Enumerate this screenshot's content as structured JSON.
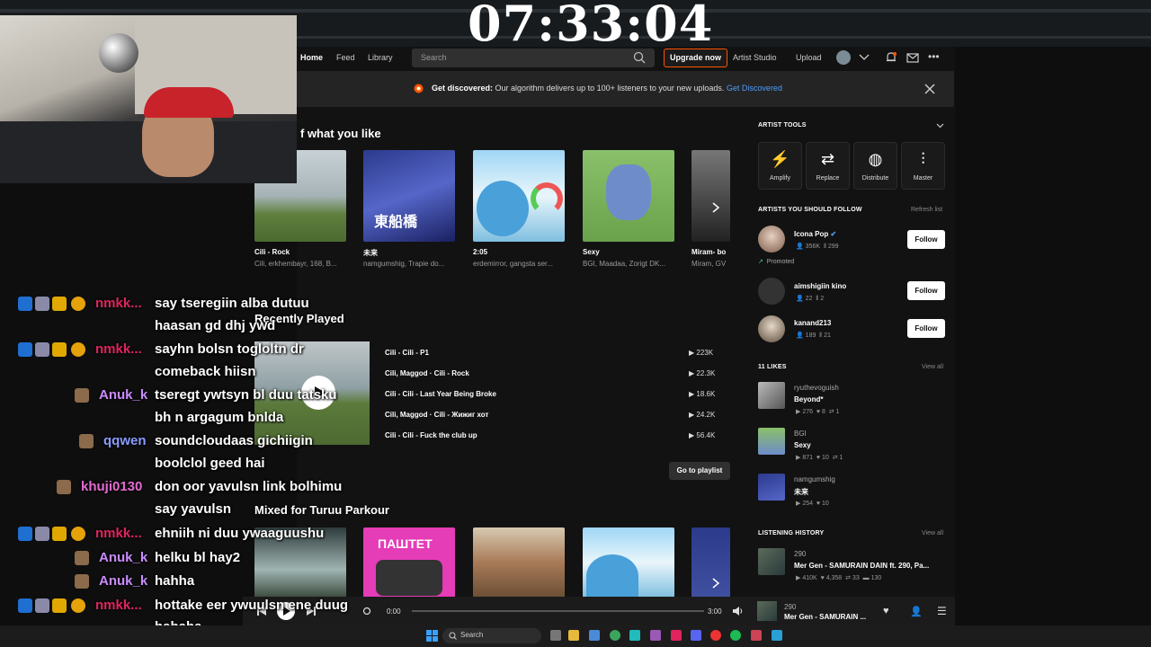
{
  "stream": {
    "timer": "07:33:04"
  },
  "nav": {
    "home": "Home",
    "feed": "Feed",
    "library": "Library",
    "search_placeholder": "Search",
    "upgrade": "Upgrade now",
    "artist_studio": "Artist Studio",
    "upload": "Upload"
  },
  "banner": {
    "bold": "Get discovered:",
    "text": " Our algorithm delivers up to 100+ listeners to your new uploads. ",
    "link": "Get Discovered"
  },
  "section1": {
    "title": "f what you like",
    "tiles": [
      {
        "name": "Cili - Rock",
        "sub": "Cili, erkhembayr, 168, B..."
      },
      {
        "name": "未来",
        "sub": "namgumshig, Trapie do..."
      },
      {
        "name": "2:05",
        "sub": "erdemirror, gangsta ser..."
      },
      {
        "name": "Sexy",
        "sub": "BGI, Maadaa, Zorigt DK..."
      },
      {
        "name": "Miram- bo",
        "sub": "Miram, GV"
      }
    ],
    "art_text": "東船橋"
  },
  "recently_played": {
    "title": "Recently Played",
    "tracks": [
      {
        "title": "Cili - Cili - P1",
        "plays": "223K"
      },
      {
        "title": "Cili, Maggod · Cili - Rock",
        "plays": "22.3K"
      },
      {
        "title": "Cili - Cili - Last Year Being Broke",
        "plays": "18.6K"
      },
      {
        "title": "Cili, Maggod · Cili - Жижиг хот",
        "plays": "24.2K"
      },
      {
        "title": "Cili - Cili - Fuck the club up",
        "plays": "56.4K"
      }
    ],
    "goto": "Go to playlist"
  },
  "section3": {
    "title": "Mixed for Turuu Parkour",
    "art_text": "ПАШТЕТ"
  },
  "sidebar": {
    "artist_tools": "ARTIST TOOLS",
    "tools": [
      "Amplify",
      "Replace",
      "Distribute",
      "Master"
    ],
    "follow_title": "ARTISTS YOU SHOULD FOLLOW",
    "refresh": "Refresh list",
    "artists": [
      {
        "name": "Icona Pop",
        "followers": "356K",
        "tracks": "299",
        "promoted": "Promoted",
        "btn": "Follow"
      },
      {
        "name": "aimshigiin kino",
        "followers": "22",
        "tracks": "2",
        "btn": "Follow"
      },
      {
        "name": "kanand213",
        "followers": "189",
        "tracks": "21",
        "btn": "Follow"
      }
    ],
    "likes_title": "11 LIKES",
    "view_all": "View all",
    "likes": [
      {
        "artist": "ryuthevoguish",
        "title": "Beyond*",
        "plays": "276",
        "likes": "8",
        "reposts": "1"
      },
      {
        "artist": "BGI",
        "title": "Sexy",
        "plays": "871",
        "likes": "10",
        "reposts": "1"
      },
      {
        "artist": "namgumshig",
        "title": "未来",
        "plays": "254",
        "likes": "10"
      }
    ],
    "history_title": "LISTENING HISTORY",
    "history": [
      {
        "artist": "290",
        "title": "Mer Gen - SAMURAIN DAIN ft. 290, Pa...",
        "plays": "410K",
        "likes": "4,358",
        "reposts": "33",
        "comments": "130"
      }
    ]
  },
  "player": {
    "elapsed": "0:00",
    "duration": "3:00",
    "now_artist": "290",
    "now_title": "Mer Gen - SAMURAIN ..."
  },
  "chat": [
    {
      "user": "nmkk...",
      "color": "#e0245e",
      "lines": [
        "say tseregiin alba dutuu",
        "haasan gd dhj ywd"
      ]
    },
    {
      "user": "nmkk...",
      "color": "#e0245e",
      "lines": [
        "sayhn bolsn togloltn dr",
        "comeback hiisn"
      ]
    },
    {
      "user": "Anuk_k",
      "color": "#c98cff",
      "lines": [
        "tseregt ywtsyn bl duu tatsku",
        "bh n argagum bnlda"
      ]
    },
    {
      "user": "qqwen",
      "color": "#8a9bff",
      "lines": [
        "soundcloudaas gichiigin",
        "boolclol geed hai"
      ]
    },
    {
      "user": "khuji0130",
      "color": "#e36bd1",
      "lines": [
        "don oor yavulsn link bolhimu",
        "say yavulsn"
      ]
    },
    {
      "user": "nmkk...",
      "color": "#e0245e",
      "lines": [
        "ehniih ni duu ywaaguushu"
      ]
    },
    {
      "user": "Anuk_k",
      "color": "#c98cff",
      "lines": [
        "helku bl hay2"
      ]
    },
    {
      "user": "Anuk_k",
      "color": "#c98cff",
      "lines": [
        "hahha"
      ]
    },
    {
      "user": "nmkk...",
      "color": "#e0245e",
      "lines": [
        "hottake eer ywuulsn ene duug",
        "hahaha"
      ]
    }
  ],
  "taskbar": {
    "search": "Search"
  }
}
